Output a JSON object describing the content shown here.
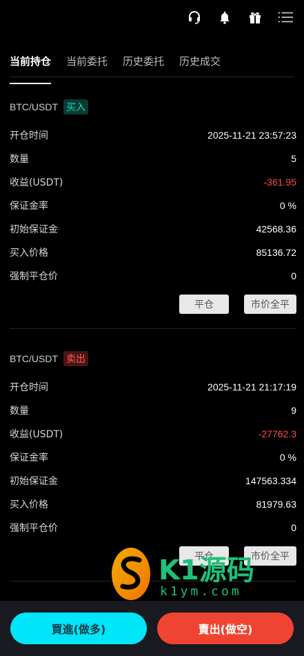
{
  "header": {
    "icons": [
      "headset-icon",
      "bell-icon",
      "gift-icon",
      "menu-icon"
    ]
  },
  "tabs": [
    {
      "label": "当前持仓",
      "active": true
    },
    {
      "label": "当前委托",
      "active": false
    },
    {
      "label": "历史委托",
      "active": false
    },
    {
      "label": "历史成交",
      "active": false
    }
  ],
  "positions": [
    {
      "pair": "BTC/USDT",
      "side": "买入",
      "rows": [
        {
          "label": "开仓时间",
          "value": "2025-11-21 23:57:23"
        },
        {
          "label": "数量",
          "value": "5"
        },
        {
          "label": "收益(USDT)",
          "value": "-361.95"
        },
        {
          "label": "保证金率",
          "value": "0 %"
        },
        {
          "label": "初始保证金",
          "value": "42568.36"
        },
        {
          "label": "买入价格",
          "value": "85136.72"
        },
        {
          "label": "强制平仓价",
          "value": "0"
        }
      ],
      "close_label": "平仓",
      "market_close_label": "市价全平"
    },
    {
      "pair": "BTC/USDT",
      "side": "卖出",
      "rows": [
        {
          "label": "开仓时间",
          "value": "2025-11-21 21:17:19"
        },
        {
          "label": "数量",
          "value": "9"
        },
        {
          "label": "收益(USDT)",
          "value": "-27762.3"
        },
        {
          "label": "保证金率",
          "value": "0 %"
        },
        {
          "label": "初始保证金",
          "value": "147563.334"
        },
        {
          "label": "买入价格",
          "value": "81979.63"
        },
        {
          "label": "强制平仓价",
          "value": "0"
        }
      ],
      "close_label": "平仓",
      "market_close_label": "市价全平"
    }
  ],
  "bottom_bar": {
    "long_label": "買進(做多)",
    "short_label": "賣出(做空)"
  },
  "watermark": {
    "brand": "K1源码",
    "url": "k1ym.com"
  },
  "colors": {
    "buy_accent": "#16e0c6",
    "sell_accent": "#ff5b50",
    "long_button": "#00e5f8",
    "short_button": "#f04433",
    "negative_value": "#ff4d4f"
  }
}
